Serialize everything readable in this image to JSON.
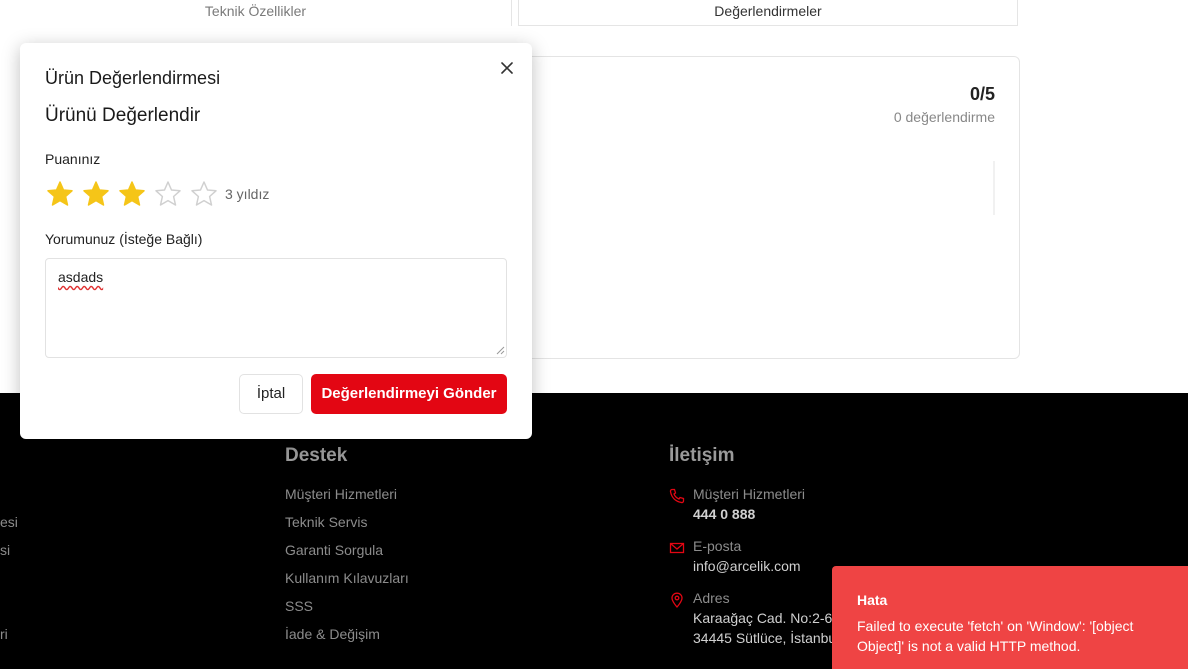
{
  "tabs": {
    "specs": "Teknik Özellikler",
    "reviews": "Değerlendirmeler"
  },
  "reviews_summary": {
    "score": "0/5",
    "count": "0 değerlendirme"
  },
  "footer": {
    "left_fragments": [
      "esi",
      "si",
      "ri"
    ],
    "support": {
      "title": "Destek",
      "links": [
        "Müşteri Hizmetleri",
        "Teknik Servis",
        "Garanti Sorgula",
        "Kullanım Kılavuzları",
        "SSS",
        "İade & Değişim"
      ]
    },
    "contact": {
      "title": "İletişim",
      "phone_label": "Müşteri Hizmetleri",
      "phone_value": "444 0 888",
      "email_label": "E-posta",
      "email_value": "info@arcelik.com",
      "address_label": "Adres",
      "address_line1": "Karaağaç Cad. No:2-6",
      "address_line2": "34445 Sütlüce, İstanbul"
    },
    "colors": {
      "background": "#000000",
      "icon": "#e30613"
    }
  },
  "modal": {
    "title": "Ürün Değerlendirmesi",
    "section_title": "Ürünü Değerlendir",
    "rating_label": "Puanınız",
    "rating_value": 3,
    "rating_max": 5,
    "rating_caption": "3 yıldız",
    "comment_label": "Yorumunuz (İsteğe Bağlı)",
    "comment_value": "asdads",
    "cancel_label": "İptal",
    "submit_label": "Değerlendirmeyi Gönder",
    "colors": {
      "star_filled": "#f5c518",
      "star_empty": "#d0d0d0",
      "submit": "#e30613"
    },
    "icons": {
      "close": "close-icon",
      "star": "star-icon"
    }
  },
  "toast": {
    "title": "Hata",
    "message": "Failed to execute 'fetch' on 'Window': '[object Object]' is not a valid HTTP method.",
    "color": "#ef4444"
  }
}
